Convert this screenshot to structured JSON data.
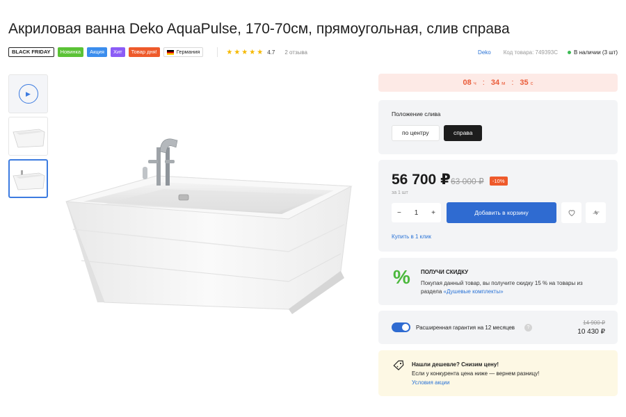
{
  "product": {
    "title": "Акриловая ванна Deko AquaPulse, 170-70см, прямоугольная, слив справа"
  },
  "badges": [
    {
      "label": "BLACK FRIDAY"
    },
    {
      "label": "Новинка"
    },
    {
      "label": "Акция"
    },
    {
      "label": "Хит"
    },
    {
      "label": "Товар дня!"
    },
    {
      "label": "Германия"
    }
  ],
  "rating": {
    "value": "4.7",
    "reviews": "2 отзыва",
    "stars": 5
  },
  "meta": {
    "brand": "Deko",
    "sku": "Код товара: 749393C",
    "stock": "В наличии (3 шт)"
  },
  "timer": {
    "hours": "08",
    "hours_unit": "ч",
    "minutes": "34",
    "minutes_unit": "м",
    "seconds": "35",
    "seconds_unit": "с",
    "separator": ":"
  },
  "drain": {
    "label": "Положение слива",
    "options": [
      "по центру",
      "справа"
    ],
    "selected": "справа"
  },
  "pricing": {
    "price": "56 700 ₽",
    "old_price": "63 000 ₽",
    "discount": "-10%",
    "unit": "за 1 шт",
    "quantity": "1",
    "minus": "−",
    "plus": "+",
    "add_to_cart": "Добавить в корзину",
    "one_click": "Купить в 1 клик"
  },
  "promo": {
    "symbol": "%",
    "title": "ПОЛУЧИ СКИДКУ",
    "text": "Покупая данный товар, вы получите скидку 15 % на товары из раздела ",
    "link": "«Душевые комплекты»"
  },
  "warranty": {
    "label": "Расширенная гарантия на 12 месяцев",
    "hint": "?",
    "old_price": "14 900 ₽",
    "price": "10 430 ₽",
    "enabled": true
  },
  "cheaper": {
    "title": "Нашли дешевле? Снизим цену!",
    "text": "Если у конкурента цена ниже — вернем разницу!",
    "link": "Условия акции"
  },
  "icons": {
    "play": "play-icon",
    "favorite": "heart-icon",
    "compare": "compare-icon",
    "tag": "price-tag-icon"
  },
  "colors": {
    "accent": "#2f6bd1",
    "timer_bg": "#fdeae6",
    "timer_text": "#ea5b38",
    "discount": "#ee5a2b",
    "promo_green": "#4bb83c",
    "cheaper_bg": "#fdf8e4"
  }
}
